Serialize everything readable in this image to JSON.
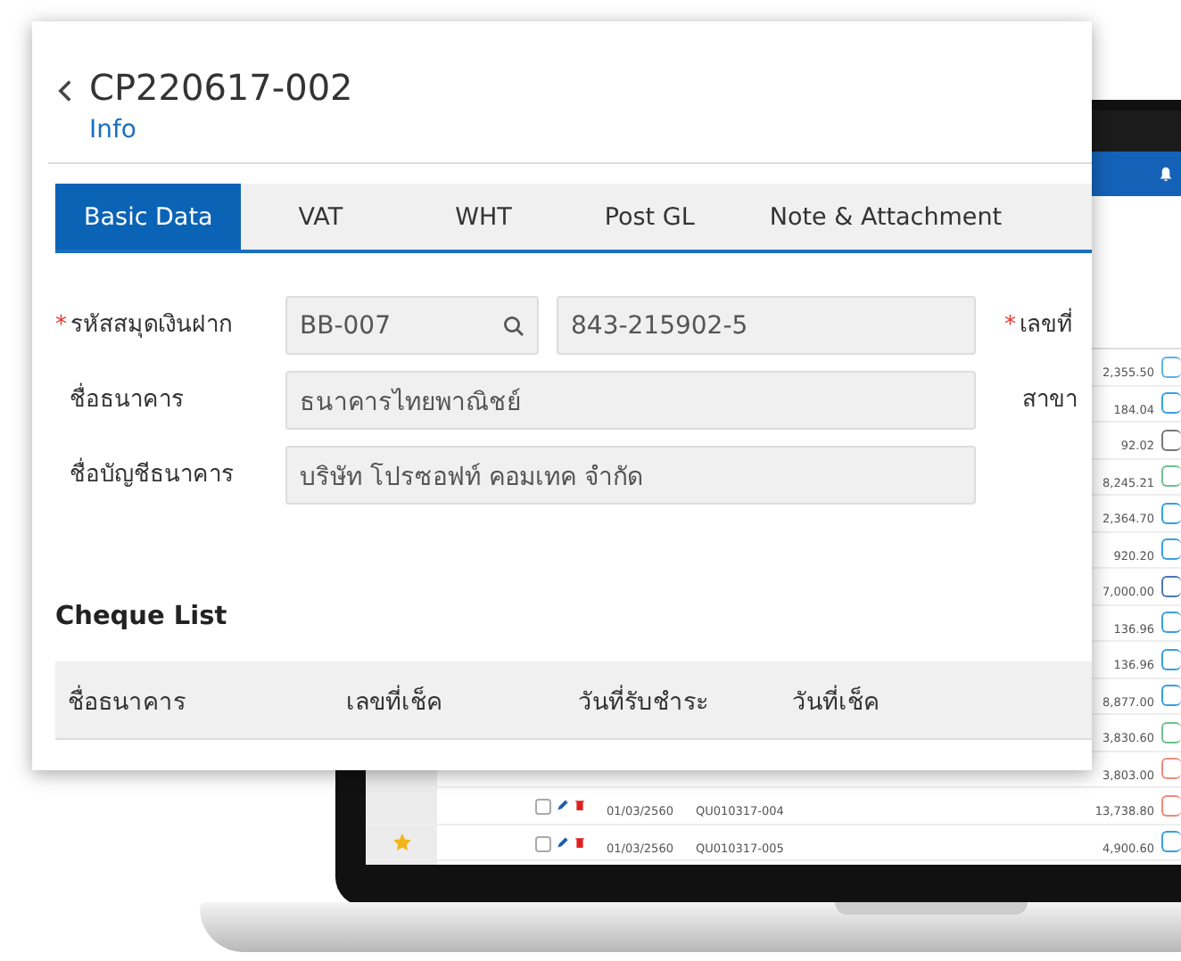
{
  "dialog": {
    "title": "CP220617-002",
    "subtitle": "Info",
    "tabs": [
      {
        "label": "Basic Data",
        "selected": true
      },
      {
        "label": "VAT",
        "selected": false
      },
      {
        "label": "WHT",
        "selected": false
      },
      {
        "label": "Post GL",
        "selected": false
      },
      {
        "label": "Note & Attachment",
        "selected": false
      }
    ],
    "fields": [
      {
        "required_mark": "*",
        "label": "รหัสสมุดเงินฝาก",
        "kind": "lookup",
        "value": "BB-007",
        "value_2": "843-215902-5",
        "side_required_mark": "*",
        "side_label": "เลขที่"
      },
      {
        "label": "ชื่อธนาคาร",
        "kind": "text",
        "value": "ธนาคารไทยพาณิชย์",
        "side_label": "สาขา"
      },
      {
        "label": "ชื่อบัญชีธนาคาร",
        "kind": "text",
        "value": "บริษัท โปรซอฟท์ คอมเทค จำกัด"
      }
    ],
    "cheque_list": {
      "title": "Cheque List",
      "columns": [
        "ชื่อธนาคาร",
        "เลขที่เช็ค",
        "วันที่รับชำระ",
        "วันที่เช็ค"
      ]
    }
  },
  "laptop_screen": {
    "rows": [
      {
        "amount": "2,355.50",
        "color": "#5ab4e8"
      },
      {
        "amount": "184.04",
        "color": "#3a9ee0"
      },
      {
        "amount": "92.02",
        "color": "#777777"
      },
      {
        "amount": "8,245.21",
        "color": "#6cc28a"
      },
      {
        "amount": "2,364.70",
        "color": "#3a9ee0"
      },
      {
        "amount": "920.20",
        "color": "#3a9ee0"
      },
      {
        "amount": "7,000.00",
        "color": "#4a78b8"
      },
      {
        "amount": "136.96",
        "color": "#3a9ee0"
      },
      {
        "amount": "136.96",
        "color": "#3a9ee0"
      },
      {
        "amount": "8,877.00",
        "color": "#3a9ee0"
      },
      {
        "amount": "3,830.60",
        "color": "#6cc28a"
      },
      {
        "amount": "3,803.00",
        "color": "#f08a7a"
      },
      {
        "amount": "13,738.80",
        "color": "#f08a7a",
        "date": "01/03/2560",
        "document": "QU010317-004",
        "checked": false
      },
      {
        "amount": "4,900.60",
        "color": "#3a9ee0",
        "date": "01/03/2560",
        "document": "QU010317-005",
        "checked": false,
        "starred": true
      }
    ]
  }
}
